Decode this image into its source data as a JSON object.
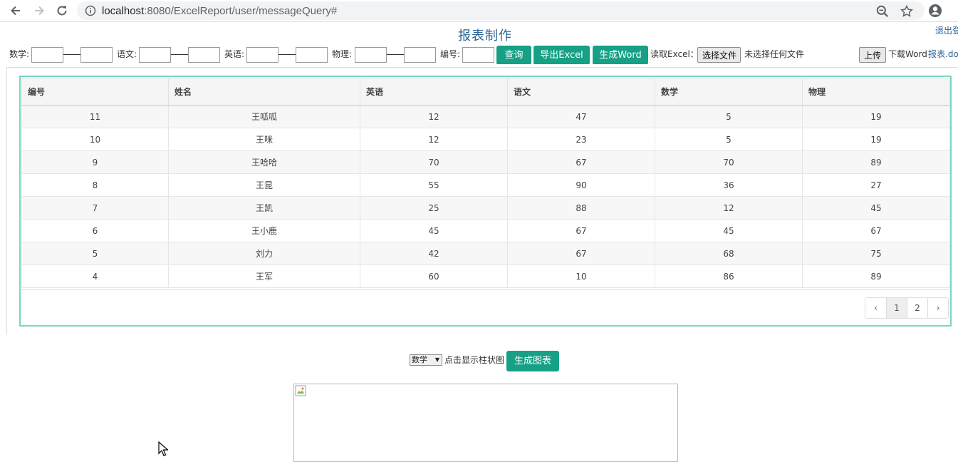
{
  "browser": {
    "url_host": "localhost",
    "url_rest": ":8080/ExcelReport/user/messageQuery#"
  },
  "page": {
    "title": "报表制作",
    "logout": "退出登"
  },
  "filters": {
    "math_label": "数学:",
    "chinese_label": "语文:",
    "english_label": "英语:",
    "physics_label": "物理:",
    "id_label": "编号:",
    "query_button": "查询",
    "export_excel_button": "导出Excel",
    "gen_word_button": "生成Word",
    "read_excel_label": "读取Excel：",
    "choose_file_button": "选择文件",
    "no_file_text": "未选择任何文件",
    "upload_button": "上传",
    "download_word_label": "下载Word",
    "download_word_link": "报表.do"
  },
  "table": {
    "headers": [
      "编号",
      "姓名",
      "英语",
      "语文",
      "数学",
      "物理"
    ],
    "rows": [
      [
        "11",
        "王呱呱",
        "12",
        "47",
        "5",
        "19"
      ],
      [
        "10",
        "王咪",
        "12",
        "23",
        "5",
        "19"
      ],
      [
        "9",
        "王哈哈",
        "70",
        "67",
        "70",
        "89"
      ],
      [
        "8",
        "王昆",
        "55",
        "90",
        "36",
        "27"
      ],
      [
        "7",
        "王凯",
        "25",
        "88",
        "12",
        "45"
      ],
      [
        "6",
        "王小鹿",
        "45",
        "67",
        "45",
        "67"
      ],
      [
        "5",
        "刘力",
        "42",
        "67",
        "68",
        "75"
      ],
      [
        "4",
        "王军",
        "60",
        "10",
        "86",
        "89"
      ]
    ]
  },
  "pagination": {
    "prev": "‹",
    "pages": [
      "1",
      "2"
    ],
    "current": "1",
    "next": "›"
  },
  "chart_controls": {
    "subject_selected": "数学",
    "hint": "点击显示柱状图",
    "generate_button": "生成图表"
  },
  "colors": {
    "accent": "#16a085",
    "panel_border": "#76d7c4",
    "link": "#2a6496"
  }
}
